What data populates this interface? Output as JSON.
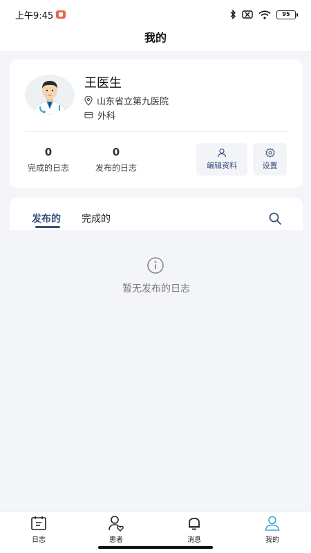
{
  "status_bar": {
    "time": "上午9:45",
    "battery": "95"
  },
  "header": {
    "title": "我的"
  },
  "profile": {
    "name": "王医生",
    "hospital": "山东省立第九医院",
    "department": "外科",
    "stats": {
      "completed_count": "0",
      "completed_label": "完成的日志",
      "published_count": "0",
      "published_label": "发布的日志"
    },
    "actions": {
      "edit_label": "编辑资料",
      "settings_label": "设置"
    }
  },
  "logs": {
    "tabs": [
      {
        "label": "发布的",
        "active": true
      },
      {
        "label": "完成的",
        "active": false
      }
    ],
    "empty_text": "暂无发布的日志"
  },
  "bottom_nav": {
    "items": [
      {
        "label": "日志",
        "icon": "calendar-icon"
      },
      {
        "label": "患者",
        "icon": "patient-icon"
      },
      {
        "label": "消息",
        "icon": "bell-icon"
      },
      {
        "label": "我的",
        "icon": "user-icon",
        "active": true
      }
    ],
    "active_color": "#3aa8c8"
  }
}
